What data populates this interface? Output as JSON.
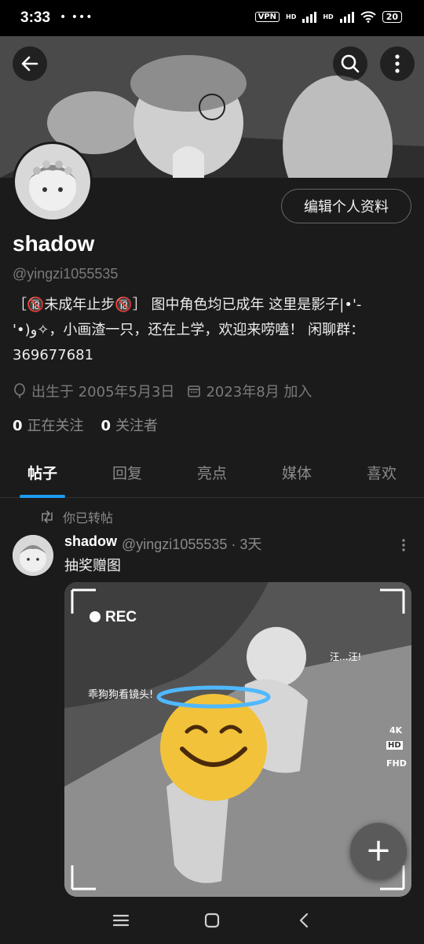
{
  "status_bar": {
    "time": "3:33",
    "notif_dots": "• •••",
    "vpn": "VPN",
    "signal1": "HD",
    "signal2": "HD",
    "battery": "20"
  },
  "profile": {
    "edit_button": "编辑个人资料",
    "name": "shadow",
    "handle": "@yingzi1055535",
    "bio": "［🔞未成年止步🔞］ 图中角色均已成年 这里是影子|•'-'•)و✧，小画渣一只，还在上学，欢迎来唠嗑！ 闲聊群：369677681",
    "birth": "出生于 2005年5月3日",
    "joined": "2023年8月 加入",
    "following_count": "0",
    "following_label": "正在关注",
    "followers_count": "0",
    "followers_label": "关注者"
  },
  "tabs": [
    {
      "label": "帖子"
    },
    {
      "label": "回复"
    },
    {
      "label": "亮点"
    },
    {
      "label": "媒体"
    },
    {
      "label": "喜欢"
    }
  ],
  "post": {
    "repost_label": "你已转帖",
    "author": "shadow",
    "handle_time": "@yingzi1055535 · 3天",
    "text": "抽奖赠图",
    "media": {
      "rec": "REC",
      "caption_left": "乖狗狗看镜头!",
      "caption_right": "汪...汪!",
      "q1": "4K",
      "q2": "HD",
      "q3": "FHD"
    }
  },
  "fab_label": "+",
  "colors": {
    "accent": "#1d9bf0",
    "background": "#1b1b1b"
  }
}
